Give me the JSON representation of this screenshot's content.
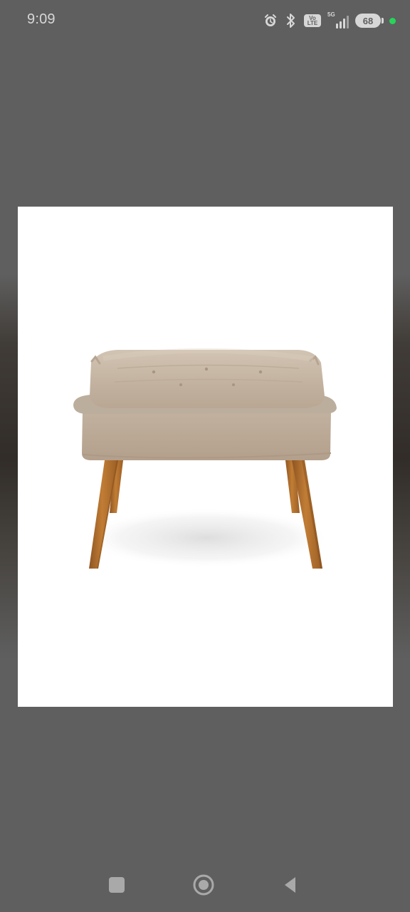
{
  "status_bar": {
    "time": "9:09",
    "battery_level": "68",
    "network": "5G",
    "volte_top": "Vo",
    "volte_bottom": "LTE",
    "icons": [
      "alarm-icon",
      "bluetooth-icon",
      "volte-icon",
      "signal-icon",
      "battery-icon",
      "active-indicator-dot"
    ]
  },
  "image_viewer": {
    "image_subject": "beige tufted ottoman with wooden legs"
  },
  "navigation": {
    "buttons": [
      "recent-apps-icon",
      "home-icon",
      "back-icon"
    ]
  },
  "colors": {
    "background": "#5f5f5f",
    "image_background": "#ffffff",
    "cushion": "#c8b8a7",
    "legs": "#b06f2c",
    "active_dot": "#27d35a"
  }
}
